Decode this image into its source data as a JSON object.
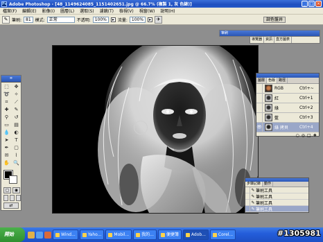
{
  "window": {
    "app_icon": "Ps",
    "title": "Adobe Photoshop - [48_1149624085_1151402651.jpg @ 66.7% (複製 1, 灰 色錶)]",
    "btn_min": "_",
    "btn_max": "□",
    "btn_close": "×"
  },
  "menu": [
    "檔案(F)",
    "編輯(E)",
    "影像(I)",
    "圖層(L)",
    "選取(S)",
    "濾鏡(T)",
    "檢視(V)",
    "視窗(W)",
    "說明(H)"
  ],
  "options": {
    "brush_label": "筆刷:",
    "brush_size": "81",
    "mode_label": "模式:",
    "mode_value": "正常",
    "opacity_label": "不透明:",
    "opacity_value": "100%",
    "flow_label": "流量:",
    "flow_value": "100%"
  },
  "well": {
    "tab1": "調色盤井",
    "tab2": "筆刷"
  },
  "palette_top": {
    "title": "筆刷",
    "tabs": [
      "導覽器",
      "資訊",
      "直方圖表"
    ]
  },
  "channels": {
    "tabs": [
      "圖層",
      "色版",
      "路徑"
    ],
    "rows": [
      {
        "name": "RGB",
        "key": "Ctrl+~"
      },
      {
        "name": "紅",
        "key": "Ctrl+1"
      },
      {
        "name": "綠",
        "key": "Ctrl+2"
      },
      {
        "name": "藍",
        "key": "Ctrl+3"
      },
      {
        "name": "綠 拷貝",
        "key": "Ctrl+4"
      }
    ],
    "foot": [
      "○",
      "◎",
      "□",
      "❖"
    ]
  },
  "history": {
    "tabs": [
      "步驟記錄",
      "動作"
    ],
    "rows": [
      "筆刷工具",
      "筆刷工具",
      "筆刷工具",
      "筆刷工具"
    ]
  },
  "taskbar": {
    "start": "開始",
    "buttons": [
      "Wind...",
      "Yaho...",
      "Mobil...",
      "我的...",
      "便捷簿",
      "Adob...",
      "Corel..."
    ],
    "watermark": "#1305981"
  }
}
